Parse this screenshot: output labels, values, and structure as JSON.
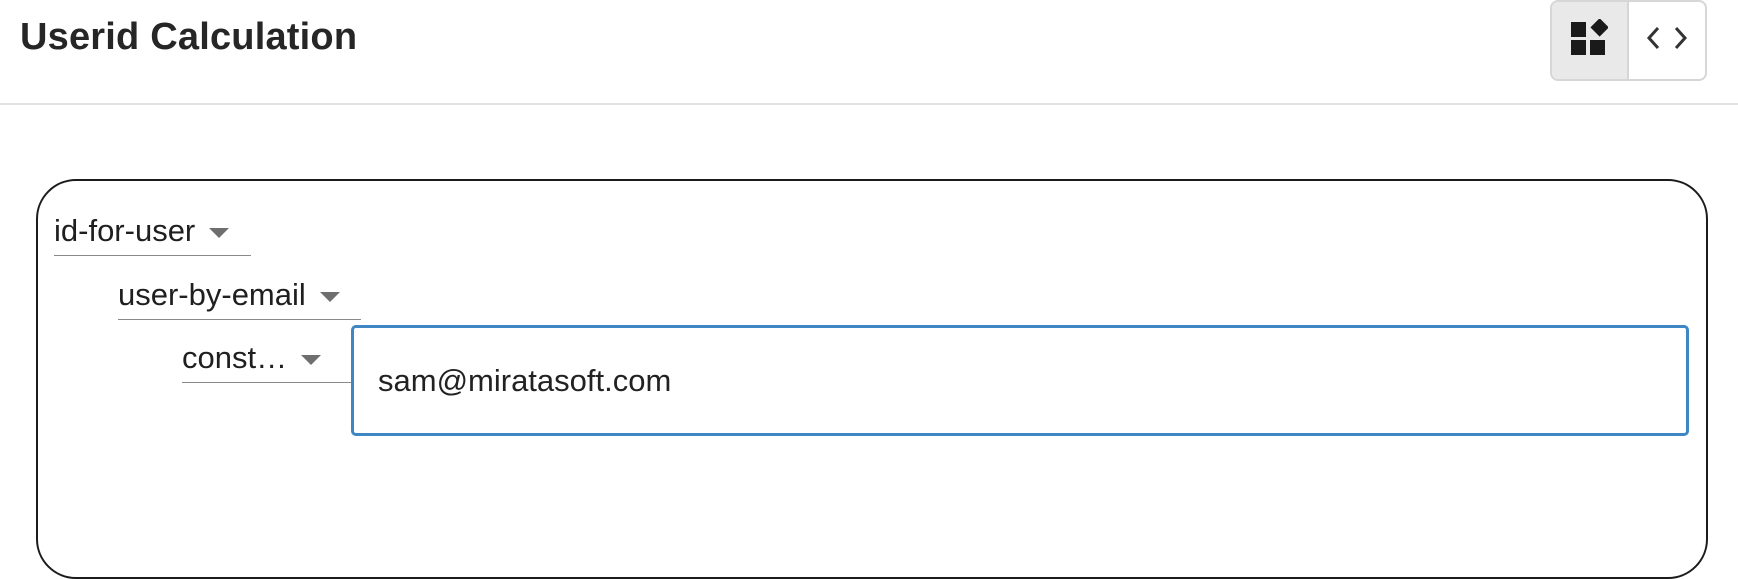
{
  "header": {
    "title": "Userid Calculation",
    "view_toggle": {
      "options": [
        {
          "icon": "blocks-icon",
          "active": true
        },
        {
          "icon": "code-icon",
          "active": false
        }
      ]
    }
  },
  "editor": {
    "blocks": [
      {
        "label": "id-for-user"
      },
      {
        "label": "user-by-email"
      },
      {
        "label": "const…"
      }
    ],
    "constant_input": {
      "value": "sam@miratasoft.com"
    }
  },
  "colors": {
    "focus_border": "#3f86c4",
    "toggle_active_bg": "#e9e9e9"
  }
}
